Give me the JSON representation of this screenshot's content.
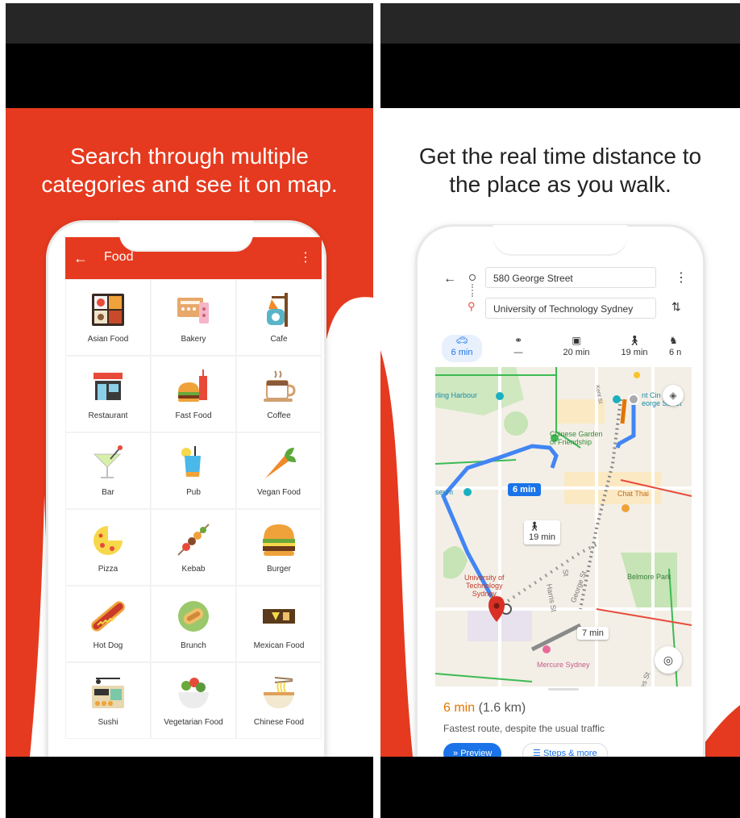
{
  "left_screen": {
    "headline": [
      "Search through multiple",
      "categories and see it on map."
    ],
    "app_bar": {
      "back_icon": "←",
      "title": "Food",
      "menu_icon": "⋮"
    },
    "categories": [
      {
        "label": "Asian Food",
        "icon": "bento-icon"
      },
      {
        "label": "Bakery",
        "icon": "bakery-icon"
      },
      {
        "label": "Cafe",
        "icon": "cafe-sign-icon"
      },
      {
        "label": "Restaurant",
        "icon": "restaurant-icon"
      },
      {
        "label": "Fast Food",
        "icon": "fast-food-icon"
      },
      {
        "label": "Coffee",
        "icon": "coffee-icon"
      },
      {
        "label": "Bar",
        "icon": "cocktail-icon"
      },
      {
        "label": "Pub",
        "icon": "drink-icon"
      },
      {
        "label": "Vegan Food",
        "icon": "carrot-icon"
      },
      {
        "label": "Pizza",
        "icon": "pizza-icon"
      },
      {
        "label": "Kebab",
        "icon": "kebab-icon"
      },
      {
        "label": "Burger",
        "icon": "burger-icon"
      },
      {
        "label": "Hot Dog",
        "icon": "hot-dog-icon"
      },
      {
        "label": "Brunch",
        "icon": "brunch-icon"
      },
      {
        "label": "Mexican Food",
        "icon": "mexican-icon"
      },
      {
        "label": "Sushi",
        "icon": "sushi-icon"
      },
      {
        "label": "Vegetarian Food",
        "icon": "salad-icon"
      },
      {
        "label": "Chinese Food",
        "icon": "noodles-icon"
      }
    ],
    "colors": {
      "brand": "#e53a1f"
    }
  },
  "right_screen": {
    "headline": [
      "Get the real time distance to",
      "the place as you walk."
    ],
    "route": {
      "origin": "580 George Street",
      "destination": "University of Technology Sydney"
    },
    "modes": [
      {
        "icon": "car-icon",
        "value": "6 min"
      },
      {
        "icon": "motorbike-icon",
        "value": "—"
      },
      {
        "icon": "transit-icon",
        "value": "20 min"
      },
      {
        "icon": "walk-icon",
        "value": "19 min"
      },
      {
        "icon": "cycle-icon",
        "value": "6 n"
      }
    ],
    "map_labels": {
      "harbour": "rling Harbour",
      "garden": "Chinese Garden of Friendship",
      "garden_line1": "Chinese Garden",
      "garden_line2": "of Friendship",
      "george": "nt Cin",
      "george2": "eorge Street",
      "chat": "Chat Thai",
      "museum": "seum",
      "belmore": "Belmore Park",
      "uni1": "University of",
      "uni2": "Technology",
      "uni3": "Sydney",
      "mercure": "Mercure Sydney",
      "george_st": "George St",
      "harris_st": "Harris St",
      "road_st": "St",
      "kent_st": "Kent St",
      "es_st": "es St",
      "badge_drive": "6 min",
      "badge_walk": "19 min",
      "badge_other": "7 min"
    },
    "summary": {
      "time": "6 min",
      "distance": "(1.6 km)",
      "note": "Fastest route, despite the usual traffic",
      "preview_label": "Preview",
      "steps_label": "Steps & more"
    },
    "colors": {
      "route": "#4285f4",
      "accent": "#e37400"
    }
  }
}
